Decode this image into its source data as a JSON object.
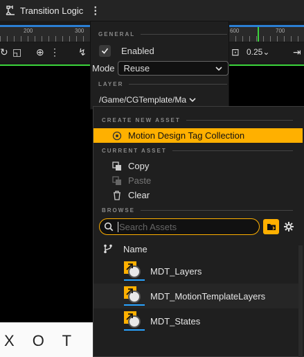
{
  "header": {
    "title": "Transition Logic"
  },
  "ruler": {
    "labels": [
      "200",
      "300",
      "600",
      "700"
    ]
  },
  "toolbar": {
    "zoom_value": "0.25"
  },
  "canvas": {
    "partial_text": "X O T"
  },
  "settings": {
    "general_heading": "GENERAL",
    "enabled_label": "Enabled",
    "enabled_checked": true,
    "mode_label": "Mode",
    "mode_value": "Reuse",
    "layer_heading": "LAYER",
    "layer_path": "/Game/CGTemplate/Ma"
  },
  "picker": {
    "create_heading": "CREATE NEW ASSET",
    "create_item": "Motion Design Tag Collection",
    "current_heading": "CURRENT ASSET",
    "current_items": [
      {
        "label": "Copy",
        "icon": "copy-icon",
        "enabled": true
      },
      {
        "label": "Paste",
        "icon": "paste-icon",
        "enabled": false
      },
      {
        "label": "Clear",
        "icon": "trash-icon",
        "enabled": true
      }
    ],
    "browse_heading": "BROWSE",
    "search_placeholder": "Search Assets",
    "column_name": "Name",
    "assets": [
      "MDT_Layers",
      "MDT_MotionTemplateLayers",
      "MDT_States"
    ]
  },
  "colors": {
    "accent": "#ffb000",
    "playhead": "#3bd43b",
    "ruler_bar": "#2b7fd4",
    "asset_underline": "#29a3ff"
  }
}
